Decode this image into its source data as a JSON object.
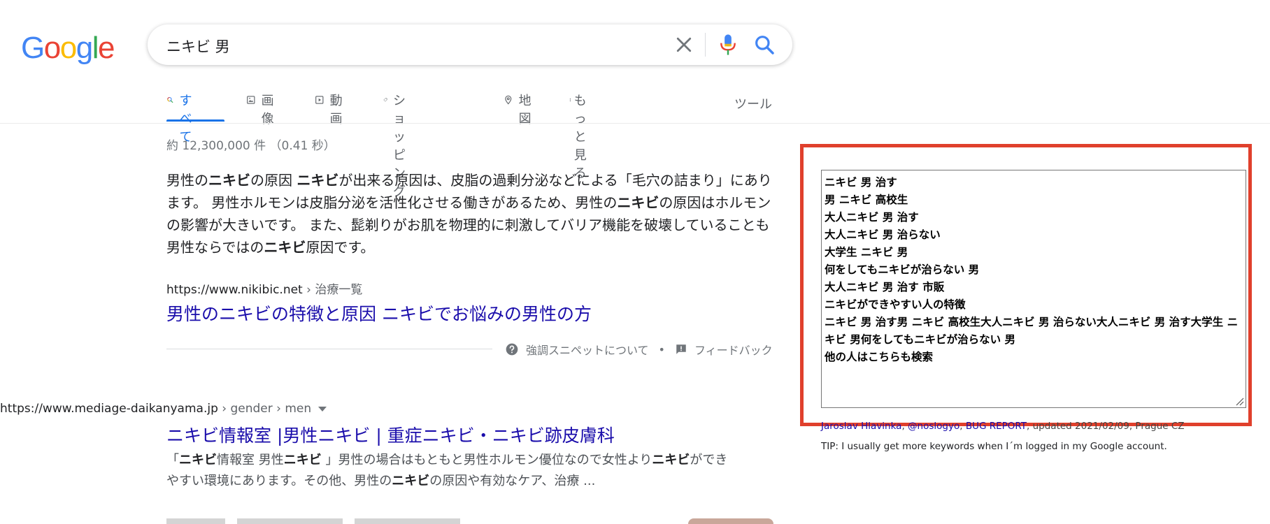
{
  "logo": {
    "letters": [
      "G",
      "o",
      "o",
      "g",
      "l",
      "e"
    ],
    "colors": [
      "#4285F4",
      "#EA4335",
      "#FBBC05",
      "#4285F4",
      "#34A853",
      "#EA4335"
    ]
  },
  "search": {
    "query": "ニキビ 男"
  },
  "tabs": [
    {
      "label": "すべて",
      "icon": "search-icon",
      "active": true
    },
    {
      "label": "画像",
      "icon": "image-icon"
    },
    {
      "label": "動画",
      "icon": "video-icon"
    },
    {
      "label": "ショッピング",
      "icon": "tag-icon"
    },
    {
      "label": "地図",
      "icon": "map-pin-icon"
    },
    {
      "label": "もっと見る",
      "icon": "more-vert-icon"
    }
  ],
  "tools_label": "ツール",
  "stats": "約 12,300,000 件 （0.41 秒）",
  "featured": {
    "snippet_parts": [
      {
        "t": "男性の"
      },
      {
        "t": "ニキビ",
        "b": true
      },
      {
        "t": "の原因 "
      },
      {
        "t": "ニキビ",
        "b": true
      },
      {
        "t": "が出来る原因は、皮脂の過剰分泌などによる「毛穴の詰まり」にあります。 男性ホルモンは皮脂分泌を活性化させる働きがあるため、男性の"
      },
      {
        "t": "ニキビ",
        "b": true
      },
      {
        "t": "の原因はホルモンの影響が大きいです。 また、髭剃りがお肌を物理的に刺激してバリア機能を破壊していることも男性ならではの"
      },
      {
        "t": "ニキビ",
        "b": true
      },
      {
        "t": "原因です。"
      }
    ],
    "domain": "https://www.nikibic.net",
    "path": " › 治療一覧",
    "title": "男性のニキビの特徴と原因 ニキビでお悩みの男性の方",
    "about_label": "強調スニペットについて",
    "separator": "•",
    "feedback_label": "フィードバック"
  },
  "result2": {
    "domain": "https://www.mediage-daikanyama.jp",
    "path": " › gender › men",
    "title": "ニキビ情報室 |男性ニキビ | 重症ニキビ・ニキビ跡皮膚科",
    "snippet_parts": [
      {
        "t": "「"
      },
      {
        "t": "ニキビ",
        "b": true
      },
      {
        "t": "情報室 男性"
      },
      {
        "t": "ニキビ",
        "b": true
      },
      {
        "t": " 」男性の場合はもともと男性ホルモン優位なので女性より"
      },
      {
        "t": "ニキビ",
        "b": true
      },
      {
        "t": "ができやすい環境にあります。その他、男性の"
      },
      {
        "t": "ニキビ",
        "b": true
      },
      {
        "t": "の原因や有効なケア、治療 ..."
      }
    ]
  },
  "extension": {
    "lines": [
      "ニキビ 男 治す",
      "男 ニキビ 高校生",
      "大人ニキビ 男 治す",
      "大人ニキビ 男 治らない",
      "大学生 ニキビ 男",
      "何をしてもニキビが治らない 男",
      "大人ニキビ 男 治す 市販",
      "ニキビができやすい人の特徴",
      "ニキビ 男 治す男 ニキビ 高校生大人ニキビ 男 治らない大人ニキビ 男 治す大学生 ニキビ 男何をしてもニキビが治らない 男",
      "他の人はこちらも検索"
    ],
    "credit_author": "Jaroslav Hlavinka",
    "credit_sep1": ", ",
    "credit_handle": "@noslogyo",
    "credit_sep2": ", ",
    "credit_bug": "BUG REPORT",
    "credit_rest": ", updated 2021/02/09, Prague CZ",
    "tip": "TIP: I usually get more keywords when I´m logged in my Google account."
  },
  "colors": {
    "accent": "#1a73e8",
    "link": "#1a0dab",
    "highlight_border": "#e0402c"
  }
}
